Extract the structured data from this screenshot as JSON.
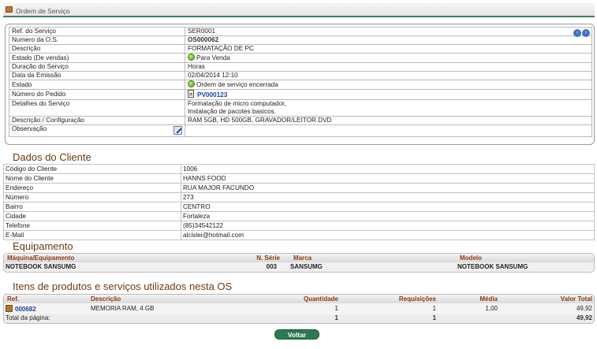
{
  "header": {
    "title": "Ordem de Serviço"
  },
  "info": {
    "rows": [
      {
        "label": "Ref. do Serviço",
        "value": "SER0001"
      },
      {
        "label": "Numero da O.S.",
        "value": "OS000062"
      },
      {
        "label": "Descrição",
        "value": "FORMATAÇÃO DE PC"
      },
      {
        "label": "Estado (De vendas)",
        "value": "Para Venda"
      },
      {
        "label": "Duração do Serviço",
        "value": "Horas"
      },
      {
        "label": "Data da Emissão",
        "value": "02/04/2014 12:10"
      },
      {
        "label": "Estado",
        "value": "Ordem de serviço encerrada"
      },
      {
        "label": "Número do Pedido",
        "value": "PV000123"
      },
      {
        "label": "Detalhes do Serviço",
        "value": "Formatação de micro computador,",
        "value2": "Instalação de pacotes basicos."
      },
      {
        "label": "Descrição / Configuração",
        "value": "RAM 5GB, HD 500GB, GRAVADOR/LEITOR DVD"
      },
      {
        "label": "Observação",
        "value": ""
      }
    ]
  },
  "client": {
    "title": "Dados do Cliente",
    "rows": [
      {
        "label": "Código do Cliente",
        "value": "1006"
      },
      {
        "label": "Nome do Cliente",
        "value": "HANNS FOOD"
      },
      {
        "label": "Endereço",
        "value": "RUA MAJOR FACUNDO"
      },
      {
        "label": "Número",
        "value": "273"
      },
      {
        "label": "Bairro",
        "value": "CENTRO"
      },
      {
        "label": "Cidade",
        "value": "Fortaleza"
      },
      {
        "label": "Telefone",
        "value": "(85)34542122"
      },
      {
        "label": "E-Mail",
        "value": "alcislei@hotmail.com"
      }
    ]
  },
  "equipment": {
    "title": "Equipamento",
    "headers": {
      "machine": "Máquina/Equipamento",
      "serial": "N. Série",
      "brand": "Marca",
      "model": "Modelo"
    },
    "row": {
      "machine": "NOTEBOOK SANSUMG",
      "serial": "003",
      "brand": "SANSUMG",
      "model": "NOTEBOOK SANSUMG"
    }
  },
  "items": {
    "title": "Itens de produtos e serviços utilizados nesta OS",
    "headers": {
      "ref": "Ref.",
      "desc": "Descrição",
      "qty": "Quantidade",
      "req": "Requisições",
      "avg": "Média",
      "total": "Valor Total"
    },
    "row": {
      "ref": "000682",
      "desc": "MEMORIA RAM, 4 GB",
      "qty": "1",
      "req": "1",
      "avg": "1,00",
      "total": "49,92"
    },
    "footer": {
      "label": "Total da página:",
      "qty": "1",
      "req": "1",
      "total": "49,92"
    }
  },
  "actions": {
    "back": "Voltar"
  }
}
